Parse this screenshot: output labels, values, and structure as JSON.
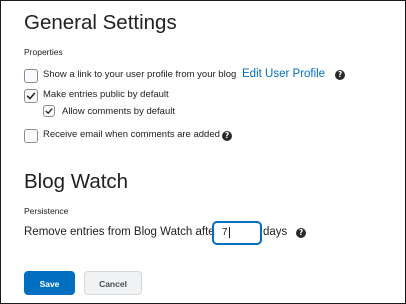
{
  "general": {
    "title": "General Settings",
    "section_label": "Properties",
    "options": [
      {
        "label": "Show a link to your user profile from your blog",
        "checked": false
      },
      {
        "label": "Make entries public by default",
        "checked": true
      },
      {
        "label": "Allow comments by default",
        "checked": true
      },
      {
        "label": "Receive email when comments are added",
        "checked": false
      }
    ],
    "edit_profile_link": "Edit User Profile"
  },
  "blog_watch": {
    "title": "Blog Watch",
    "section_label": "Persistence",
    "remove_label": "Remove entries from Blog Watch after",
    "days_value": "7",
    "days_unit": "days"
  },
  "actions": {
    "save_label": "Save",
    "cancel_label": "Cancel"
  },
  "help_icon_glyph": "?",
  "colors": {
    "accent": "#006fbf",
    "text": "#202122",
    "help_icon": "#2a2a2a",
    "cancel_bg": "#f1f2f4"
  },
  "icons": {
    "checkmark": "checkmark-icon",
    "help": "help-icon"
  }
}
